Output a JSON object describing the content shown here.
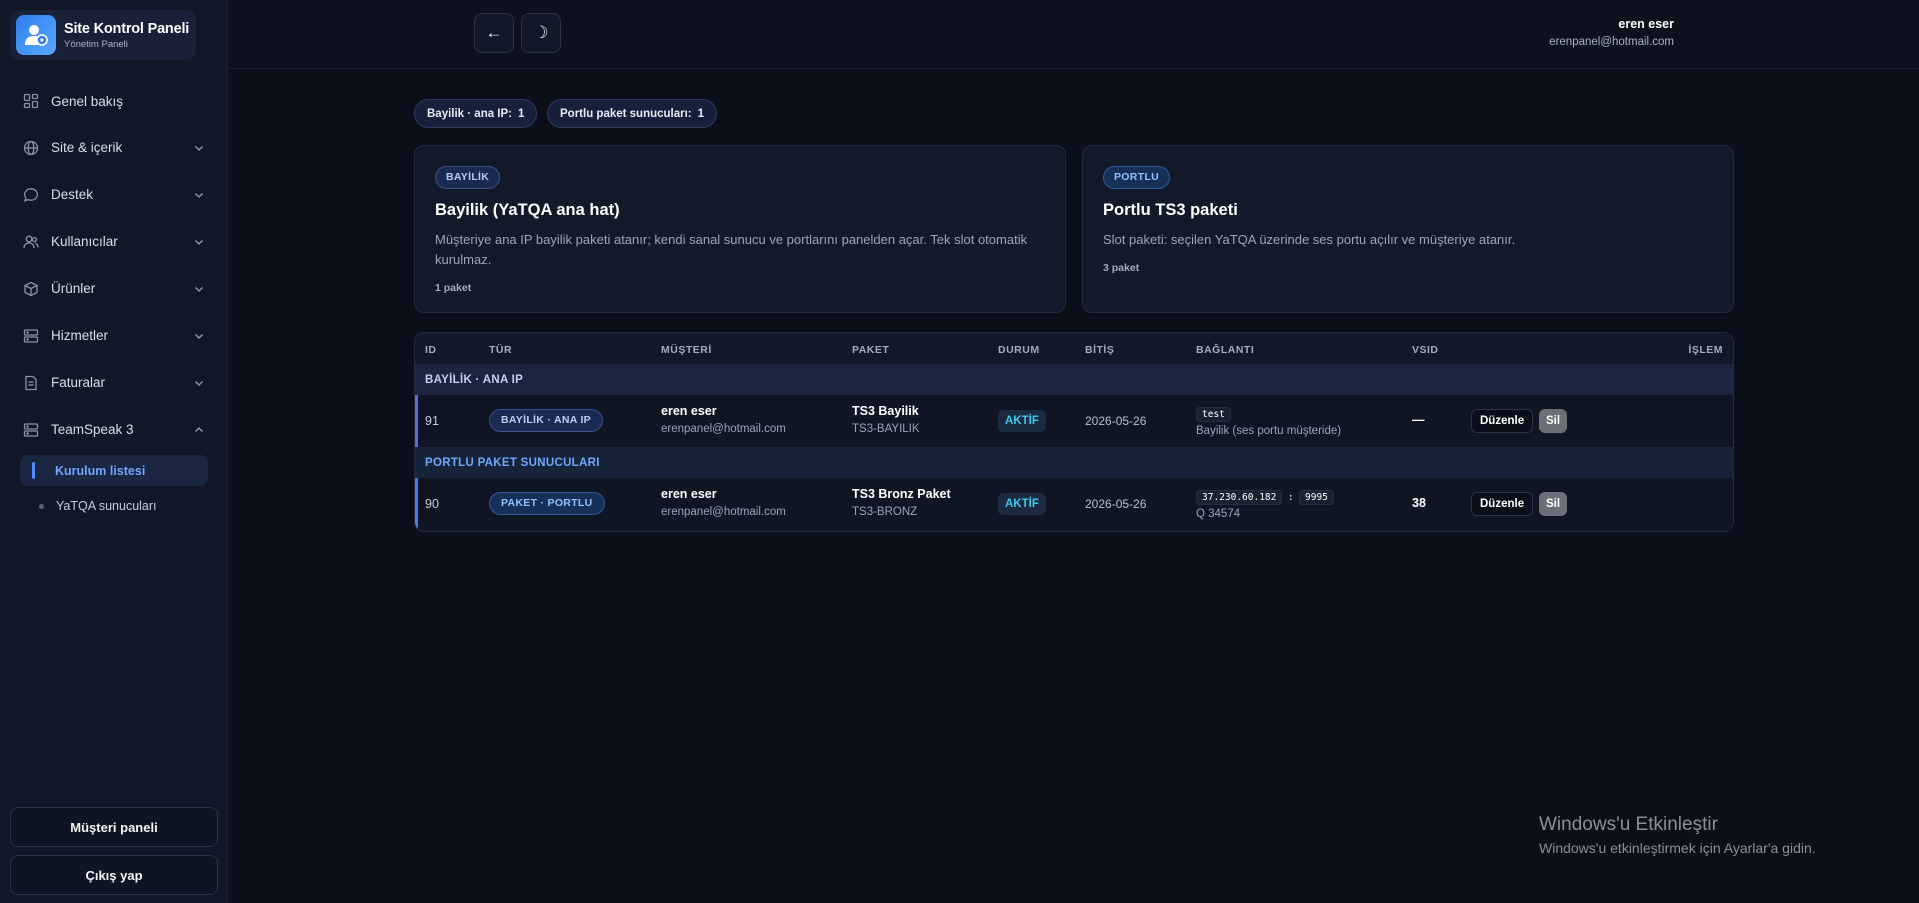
{
  "brand": {
    "title": "Site Kontrol Paneli",
    "subtitle": "Yönetim Paneli"
  },
  "sidebar": {
    "items": [
      {
        "label": "Genel bakış",
        "icon": "grid-icon"
      },
      {
        "label": "Site & içerik",
        "icon": "globe-icon"
      },
      {
        "label": "Destek",
        "icon": "chat-icon"
      },
      {
        "label": "Kullanıcılar",
        "icon": "users-icon"
      },
      {
        "label": "Ürünler",
        "icon": "box-icon"
      },
      {
        "label": "Hizmetler",
        "icon": "server-icon"
      },
      {
        "label": "Faturalar",
        "icon": "invoice-icon"
      },
      {
        "label": "TeamSpeak 3",
        "icon": "server-icon"
      }
    ],
    "subitems": [
      {
        "label": "Kurulum listesi",
        "active": true
      },
      {
        "label": "YaTQA sunucuları",
        "active": false
      }
    ],
    "customer_panel": "Müşteri paneli",
    "logout": "Çıkış yap"
  },
  "topbar": {
    "back_icon": "←",
    "theme_icon": "☽",
    "user_name": "eren eser",
    "user_email": "erenpanel@hotmail.com"
  },
  "stats": [
    {
      "label": "Bayilik · ana IP:",
      "value": "1"
    },
    {
      "label": "Portlu paket sunucuları:",
      "value": "1"
    }
  ],
  "cards": [
    {
      "tag": "BAYİLİK",
      "title": "Bayilik (YaTQA ana hat)",
      "description": "Müşteriye ana IP bayilik paketi atanır; kendi sanal sunucu ve portlarını panelden açar. Tek slot otomatik kurulmaz.",
      "count": "1 paket"
    },
    {
      "tag": "PORTLU",
      "title": "Portlu TS3 paketi",
      "description": "Slot paketi: seçilen YaTQA üzerinde ses portu açılır ve müşteriye atanır.",
      "count": "3 paket"
    }
  ],
  "table": {
    "headers": [
      "ID",
      "TÜR",
      "MÜŞTERİ",
      "PAKET",
      "DURUM",
      "BİTİŞ",
      "BAĞLANTI",
      "VSID",
      "İŞLEM"
    ],
    "groups": [
      {
        "title": "BAYİLİK · ANA IP",
        "row": {
          "id": "91",
          "type": "BAYİLİK · ANA IP",
          "customer_name": "eren eser",
          "customer_email": "erenpanel@hotmail.com",
          "package_name": "TS3 Bayilik",
          "package_code": "TS3-BAYILIK",
          "status": "AKTİF",
          "end_date": "2026-05-26",
          "connection_code": "test",
          "connection_note": "Bayilik (ses portu müşteride)",
          "vsid": "—",
          "edit": "Düzenle",
          "delete": "Sil"
        }
      },
      {
        "title": "PORTLU PAKET SUNUCULARI",
        "row": {
          "id": "90",
          "type": "PAKET · PORTLU",
          "customer_name": "eren eser",
          "customer_email": "erenpanel@hotmail.com",
          "package_name": "TS3 Bronz Paket",
          "package_code": "TS3-BRONZ",
          "status": "AKTİF",
          "end_date": "2026-05-26",
          "connection_ip": "37.230.60.182",
          "connection_sep": ":",
          "connection_port": "9995",
          "connection_note": "Q 34574",
          "vsid": "38",
          "edit": "Düzenle",
          "delete": "Sil"
        }
      }
    ]
  },
  "watermark": {
    "title": "Windows'u Etkinleştir",
    "subtitle": "Windows'u etkinleştirmek için Ayarlar'a gidin."
  }
}
